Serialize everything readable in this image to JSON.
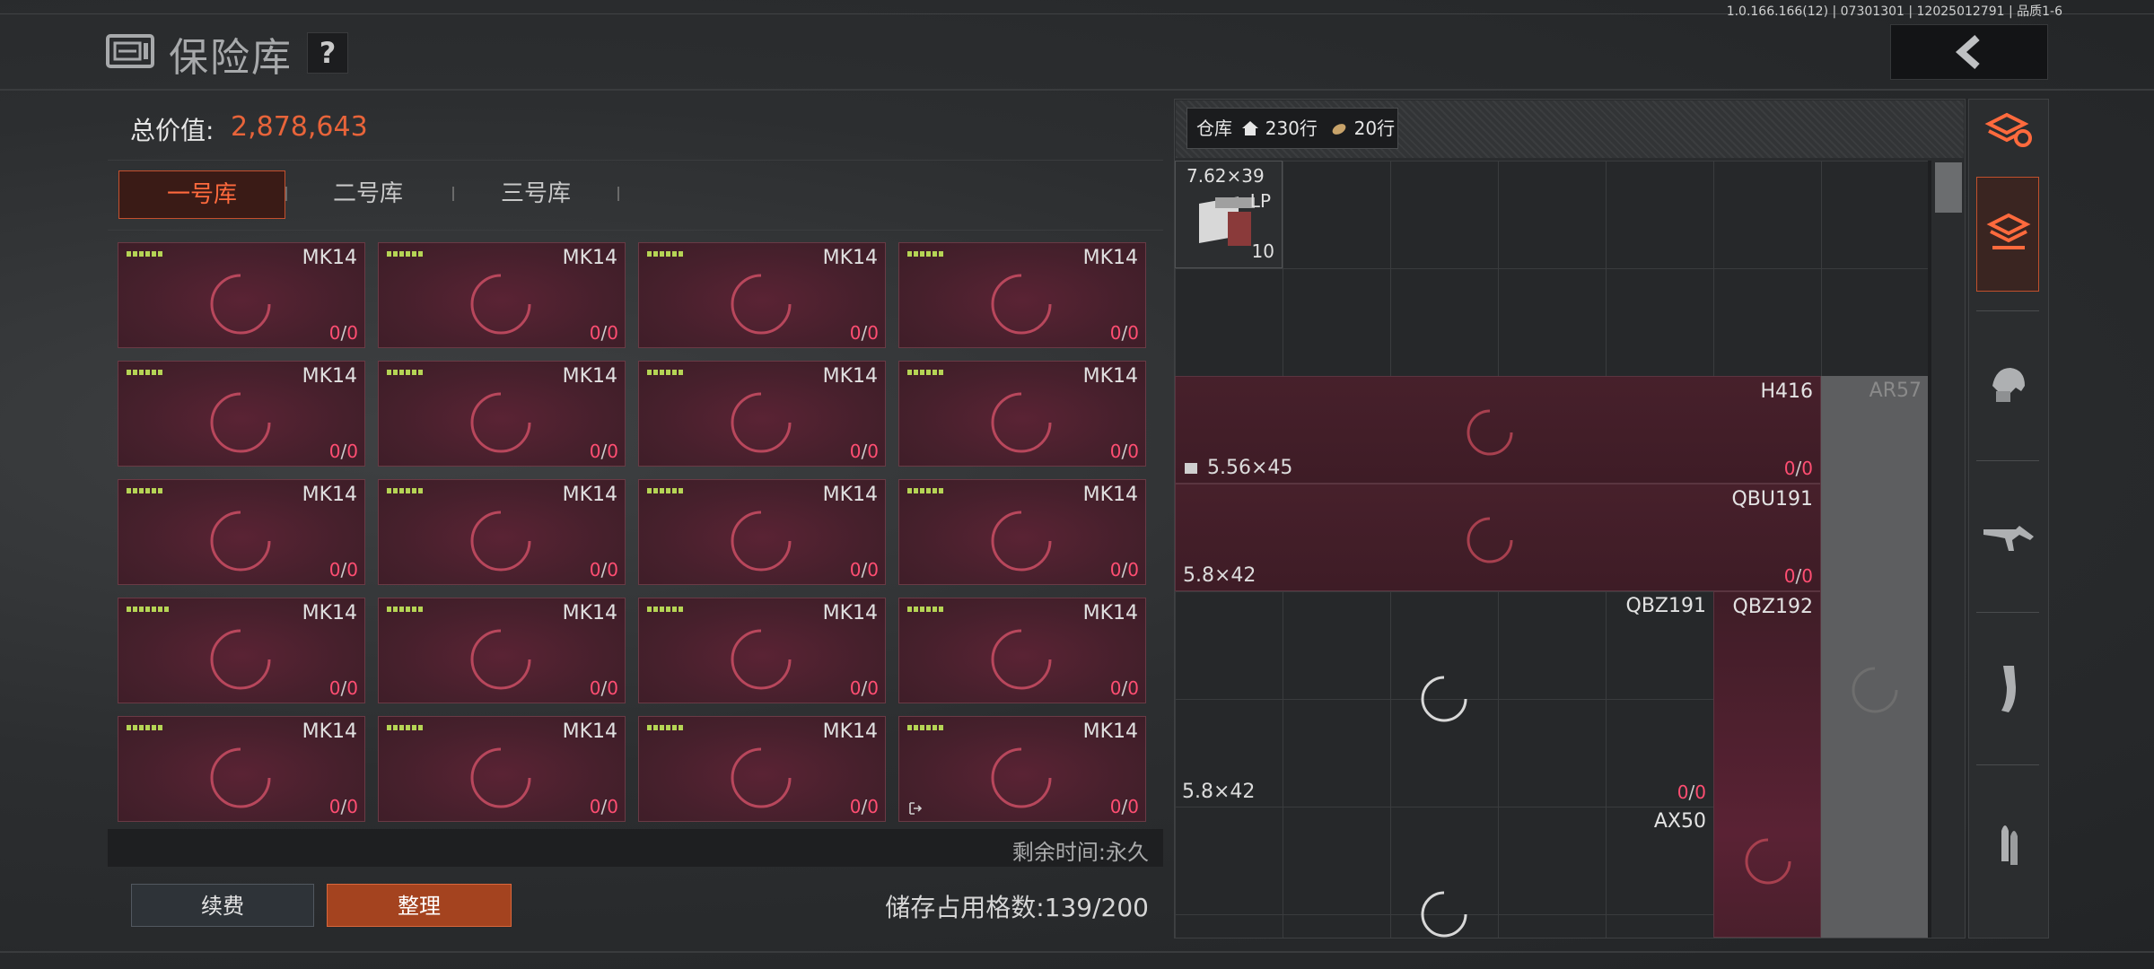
{
  "header": {
    "version": "1.0.166.166(12) | 07301301 | 12025012791 | 品质1-6",
    "title": "保险库",
    "help_label": "?",
    "back_icon": "chevron-left-icon"
  },
  "vault": {
    "total_label": "总价值:",
    "total_value": "2,878,643",
    "tabs": [
      {
        "label": "一号库",
        "active": true
      },
      {
        "label": "二号库",
        "active": false
      },
      {
        "label": "三号库",
        "active": false
      }
    ],
    "cards": [
      {
        "name": "MK14",
        "dots": 6,
        "count_a": "0",
        "count_b": "0"
      },
      {
        "name": "MK14",
        "dots": 6,
        "count_a": "0",
        "count_b": "0"
      },
      {
        "name": "MK14",
        "dots": 6,
        "count_a": "0",
        "count_b": "0"
      },
      {
        "name": "MK14",
        "dots": 6,
        "count_a": "0",
        "count_b": "0"
      },
      {
        "name": "MK14",
        "dots": 6,
        "count_a": "0",
        "count_b": "0"
      },
      {
        "name": "MK14",
        "dots": 6,
        "count_a": "0",
        "count_b": "0"
      },
      {
        "name": "MK14",
        "dots": 6,
        "count_a": "0",
        "count_b": "0"
      },
      {
        "name": "MK14",
        "dots": 6,
        "count_a": "0",
        "count_b": "0"
      },
      {
        "name": "MK14",
        "dots": 6,
        "count_a": "0",
        "count_b": "0"
      },
      {
        "name": "MK14",
        "dots": 6,
        "count_a": "0",
        "count_b": "0"
      },
      {
        "name": "MK14",
        "dots": 6,
        "count_a": "0",
        "count_b": "0"
      },
      {
        "name": "MK14",
        "dots": 6,
        "count_a": "0",
        "count_b": "0"
      },
      {
        "name": "MK14",
        "dots": 7,
        "count_a": "0",
        "count_b": "0"
      },
      {
        "name": "MK14",
        "dots": 6,
        "count_a": "0",
        "count_b": "0"
      },
      {
        "name": "MK14",
        "dots": 6,
        "count_a": "0",
        "count_b": "0"
      },
      {
        "name": "MK14",
        "dots": 6,
        "count_a": "0",
        "count_b": "0"
      },
      {
        "name": "MK14",
        "dots": 6,
        "count_a": "0",
        "count_b": "0"
      },
      {
        "name": "MK14",
        "dots": 6,
        "count_a": "0",
        "count_b": "0"
      },
      {
        "name": "MK14",
        "dots": 6,
        "count_a": "0",
        "count_b": "0"
      },
      {
        "name": "MK14",
        "dots": 6,
        "count_a": "0",
        "count_b": "0",
        "exit_icon": true
      }
    ],
    "remain_text": "剩余时间:永久",
    "renew_label": "续费",
    "sort_label": "整理",
    "storage_text": "储存占用格数:139/200"
  },
  "depot": {
    "label": "仓库",
    "rows_a": "230行",
    "rows_b": "20行",
    "items": {
      "ammo": {
        "caliber": "7.62×39",
        "tag": "LP",
        "qty": "10"
      },
      "h416": {
        "name": "H416",
        "caliber": "5.56×45",
        "count_a": "0",
        "count_b": "0"
      },
      "ar57": {
        "name": "AR57"
      },
      "qbu191": {
        "name": "QBU191",
        "caliber": "5.8×42",
        "count_a": "0",
        "count_b": "0"
      },
      "qbz191": {
        "name": "QBZ191",
        "caliber": "5.8×42",
        "count_a": "0",
        "count_b": "0"
      },
      "qbz192": {
        "name": "QBZ192"
      },
      "ax50": {
        "name": "AX50"
      }
    }
  },
  "side_tabs": [
    "stack-refresh-icon",
    "stack-tray-icon",
    "helmet-vest-icon",
    "rifle-icon",
    "magazine-icon",
    "bullets-icon"
  ],
  "colors": {
    "accent": "#e8643a",
    "count_red": "#ff4e72",
    "dots_green": "#b5d455",
    "card_bg": "#46202c"
  }
}
